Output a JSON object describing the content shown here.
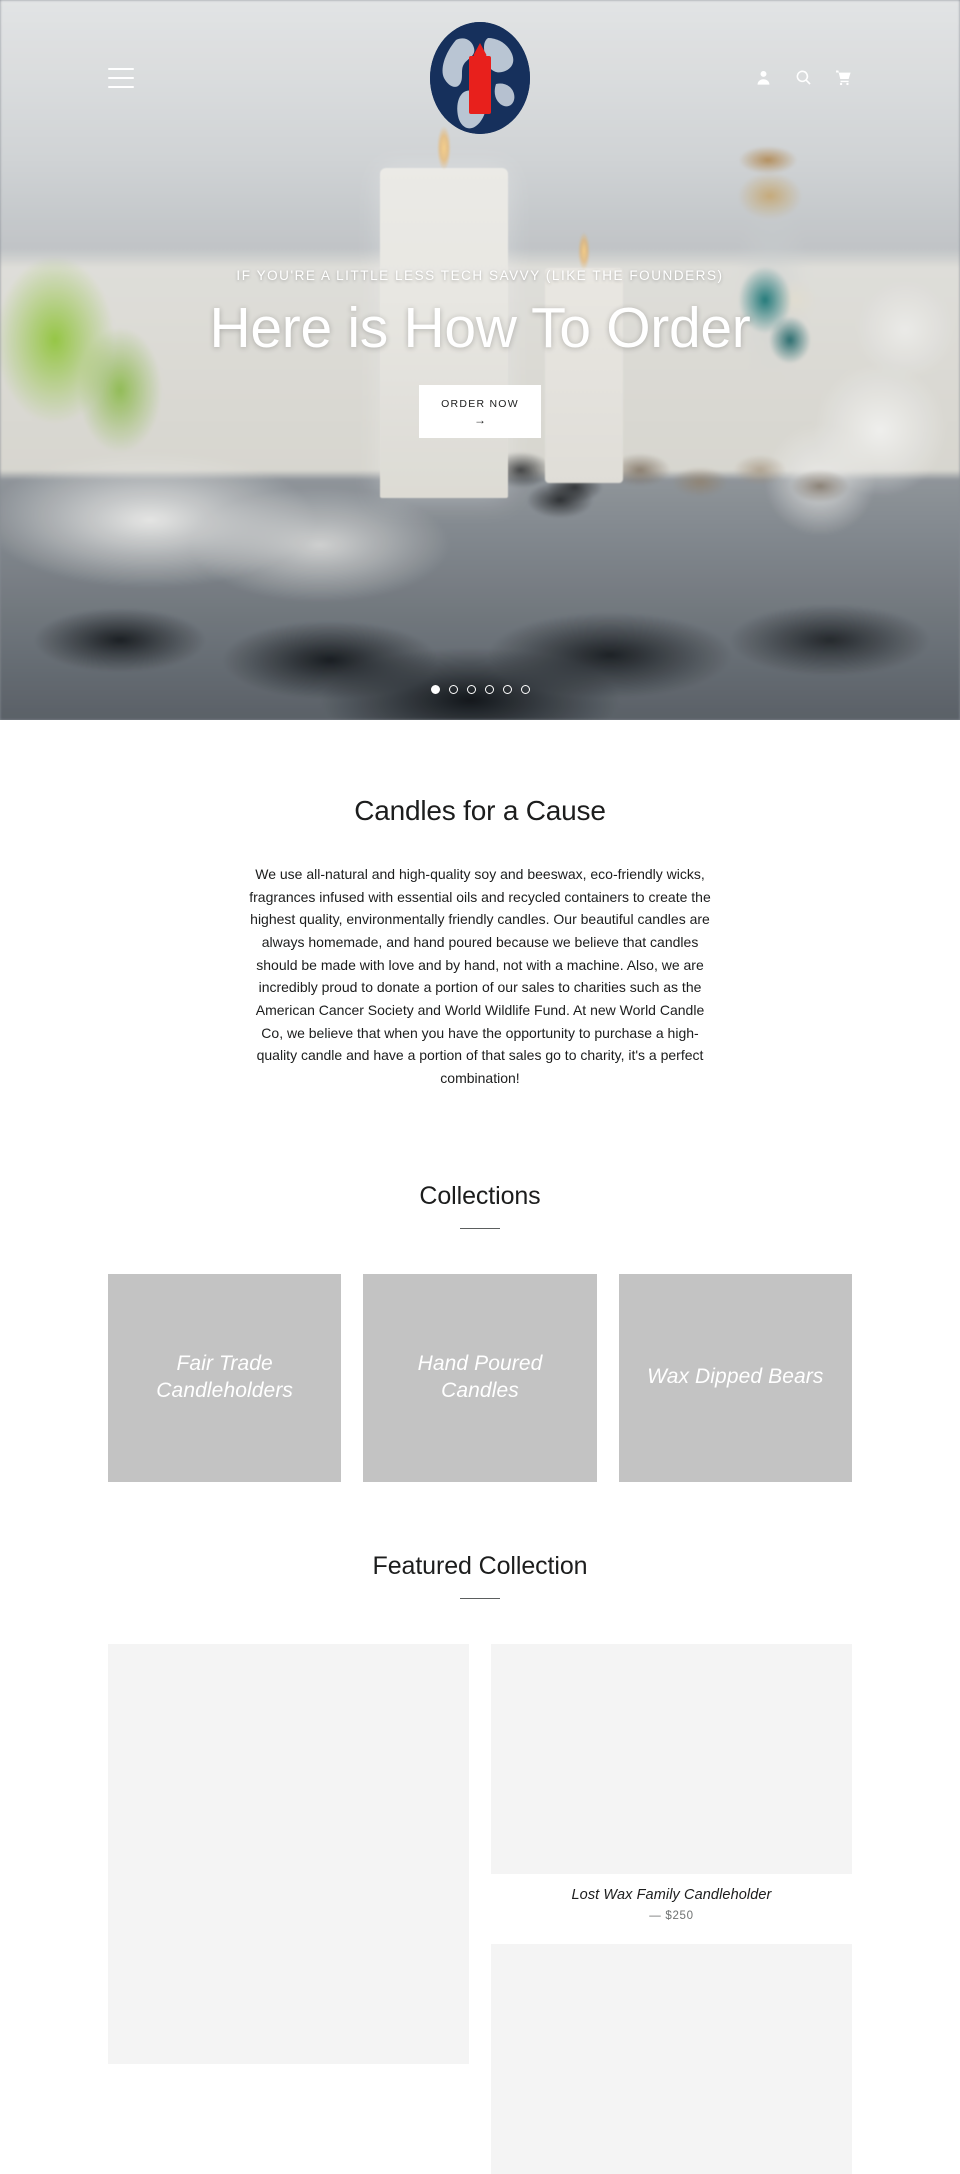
{
  "header": {
    "menu_icon": "hamburger-menu-icon",
    "logo": {
      "name": "new World Candle Co",
      "icon": "globe-candle-logo-icon"
    },
    "actions": [
      {
        "name": "account",
        "icon": "user-icon"
      },
      {
        "name": "search",
        "icon": "search-icon"
      },
      {
        "name": "cart",
        "icon": "shopping-cart-icon"
      }
    ]
  },
  "hero": {
    "subtitle": "IF YOU'RE A LITTLE LESS TECH SAVVY (LIKE THE FOUNDERS)",
    "title": "Here is How To Order",
    "button_label": "ORDER NOW",
    "button_arrow": "→",
    "slides_total": 6,
    "active_slide": 1
  },
  "rich_text": {
    "heading": "Candles for a Cause",
    "body": "We use all-natural and high-quality soy and beeswax, eco-friendly wicks, fragrances infused with essential oils and recycled containers to create the highest quality, environmentally friendly candles. Our beautiful candles are always homemade, and hand poured because we believe that candles should be made with love and by hand, not with a machine. Also, we are incredibly proud to donate a portion of our sales to charities such as the American Cancer Society and World Wildlife Fund.  At new World Candle Co, we believe that when you have the opportunity to purchase a high-quality candle and have a portion of that sales go to charity, it's a perfect combination!"
  },
  "collections": {
    "heading": "Collections",
    "items": [
      {
        "title": "Fair Trade Candleholders"
      },
      {
        "title": "Hand Poured Candles"
      },
      {
        "title": "Wax Dipped Bears"
      }
    ]
  },
  "featured": {
    "heading": "Featured Collection",
    "products": [
      {
        "name": "",
        "price": ""
      },
      {
        "name": "Lost Wax Family Candleholder",
        "price": "— $250"
      }
    ]
  },
  "colors": {
    "logo_navy": "#16305c",
    "logo_red": "#e8201c",
    "placeholder_gray": "#c3c3c3",
    "product_placeholder": "#f4f4f4",
    "text": "#1c1d1d"
  }
}
